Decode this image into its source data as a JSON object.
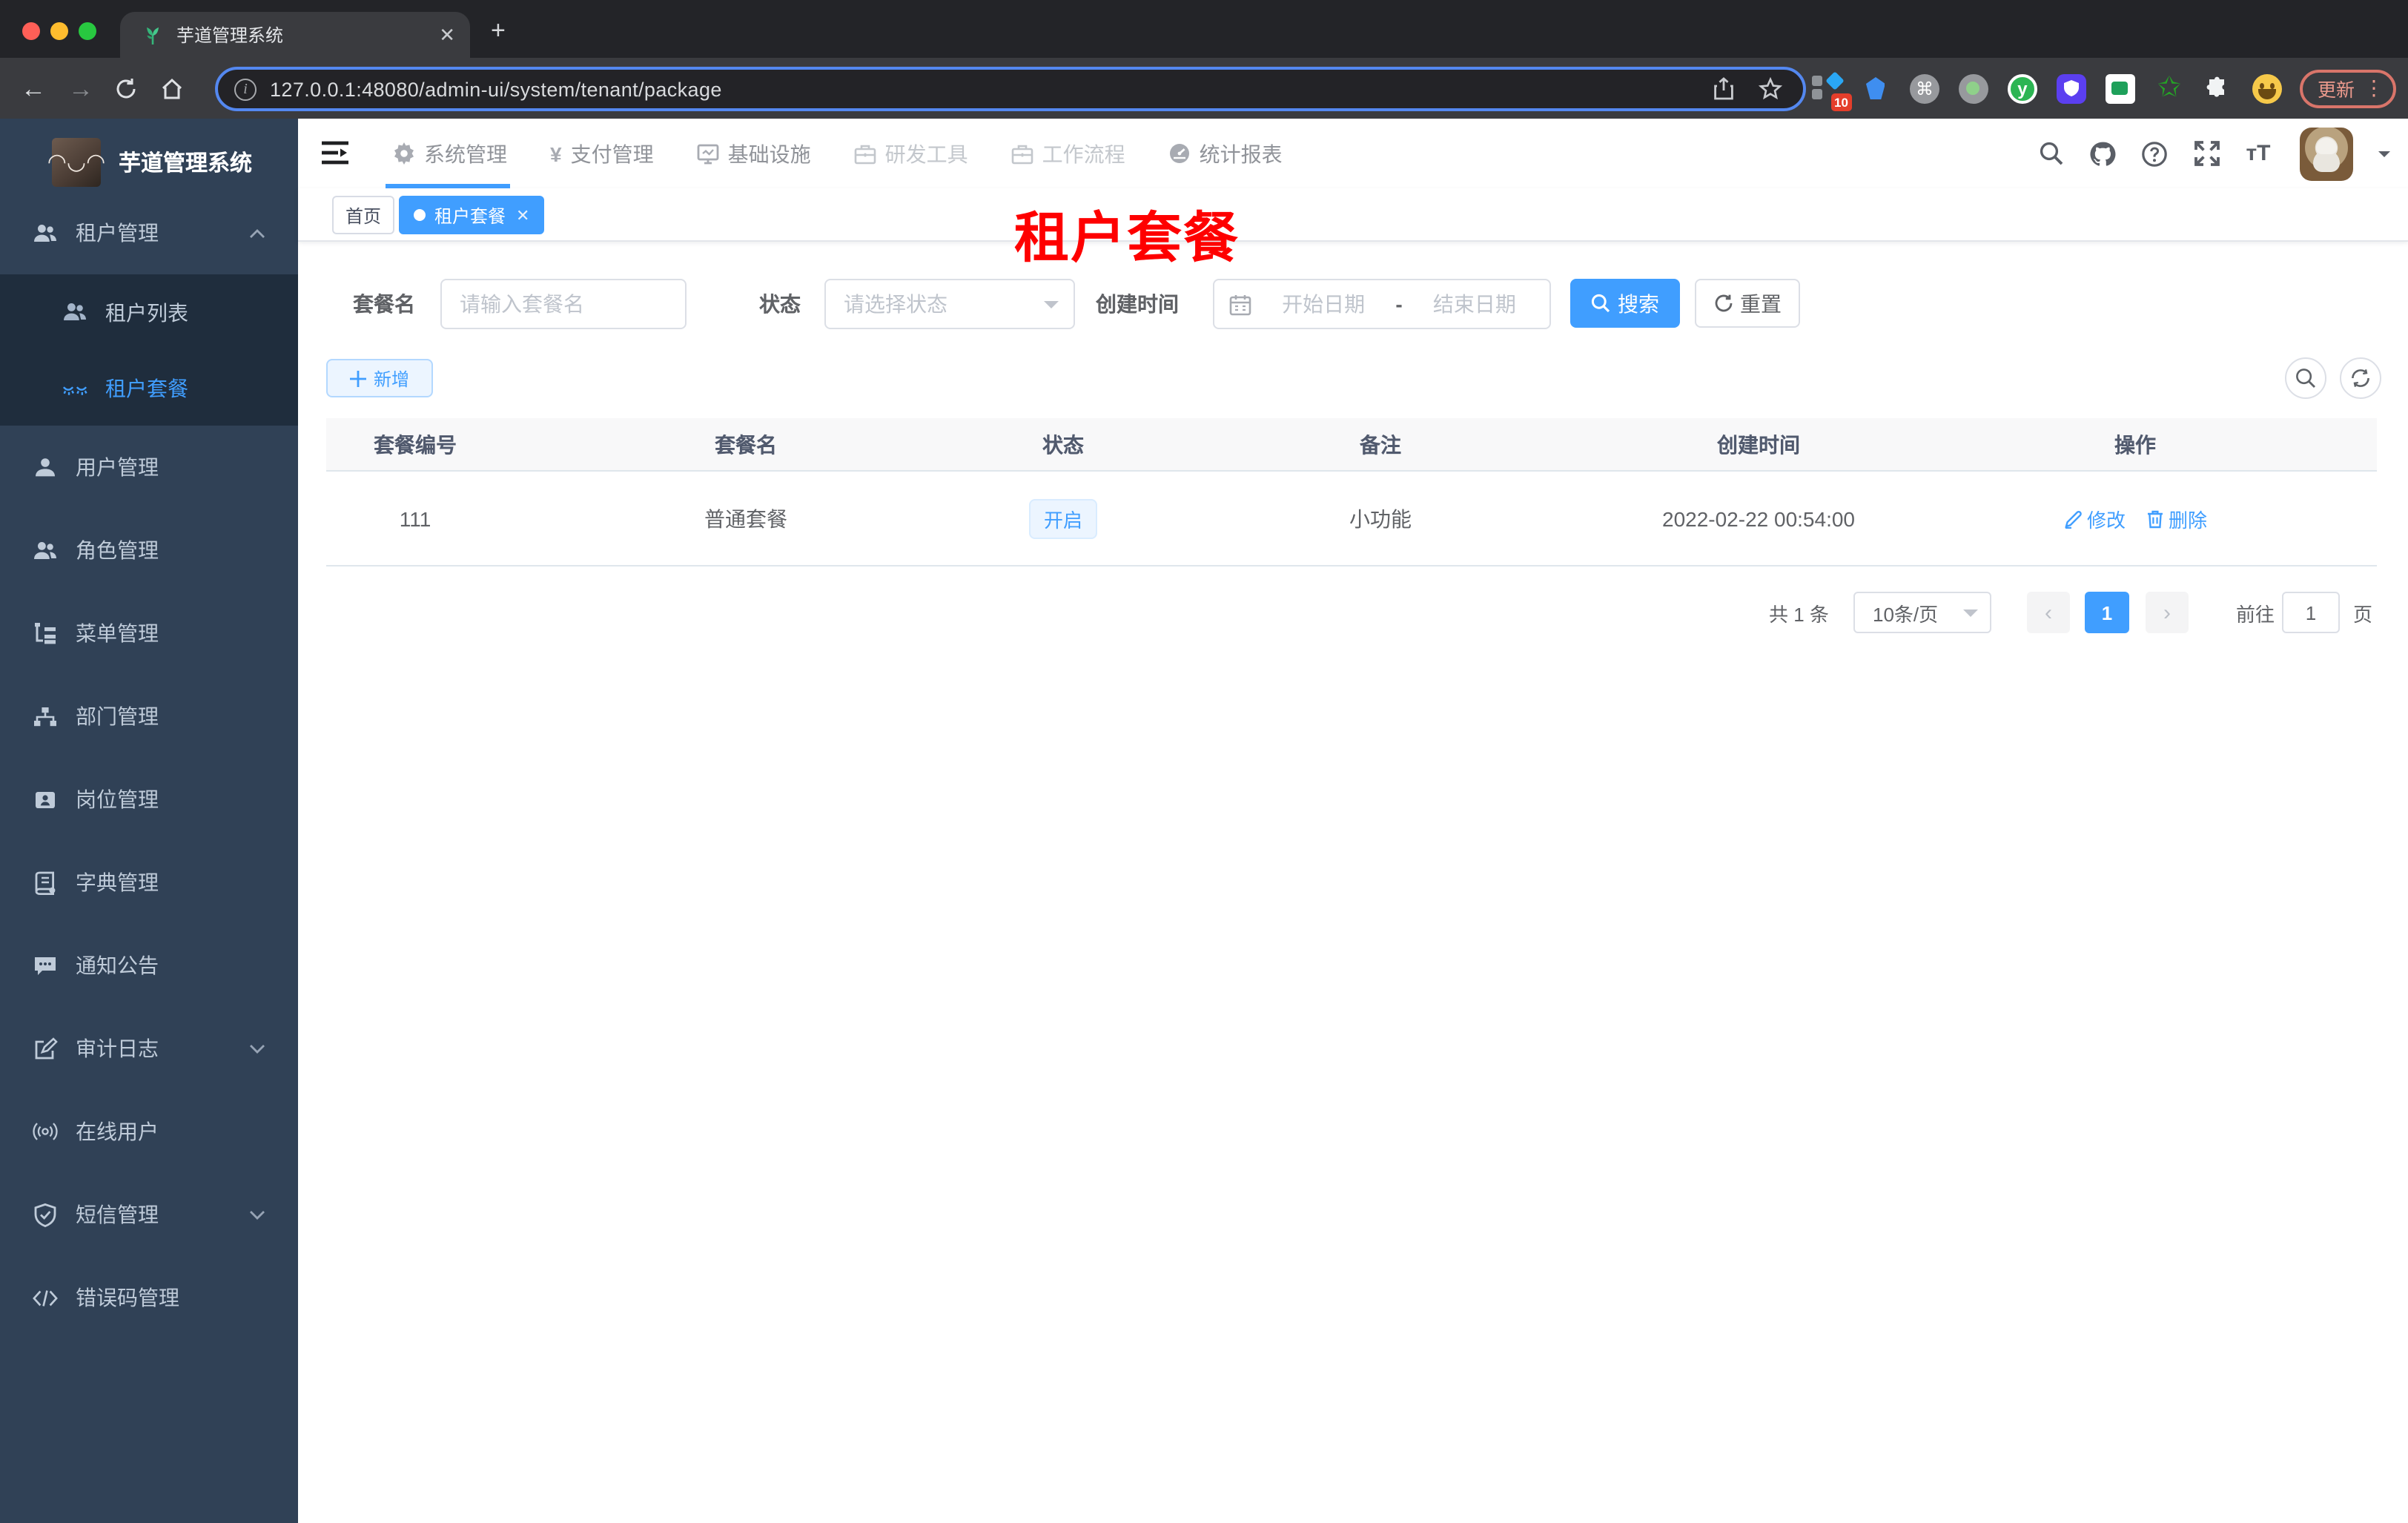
{
  "colors": {
    "accent": "#409eff",
    "sidebar_bg": "#304156",
    "submenu_bg": "#1f2d3d",
    "annotation_red": "#fe0000",
    "table_header_bg": "#f8f8f9",
    "tag_bg": "#ecf5ff",
    "tag_border": "#d9ecff"
  },
  "browser": {
    "tab_title": "芋道管理系统",
    "url": "127.0.0.1:48080/admin-ui/system/tenant/package",
    "extension_badge": "10",
    "update_label": "更新"
  },
  "sidebar": {
    "logo_title": "芋道管理系统",
    "items": [
      {
        "label": "租户管理"
      },
      {
        "label": "租户列表"
      },
      {
        "label": "租户套餐"
      },
      {
        "label": "用户管理"
      },
      {
        "label": "角色管理"
      },
      {
        "label": "菜单管理"
      },
      {
        "label": "部门管理"
      },
      {
        "label": "岗位管理"
      },
      {
        "label": "字典管理"
      },
      {
        "label": "通知公告"
      },
      {
        "label": "审计日志"
      },
      {
        "label": "在线用户"
      },
      {
        "label": "短信管理"
      },
      {
        "label": "错误码管理"
      }
    ]
  },
  "navbar": {
    "items": [
      {
        "label": "系统管理"
      },
      {
        "label": "支付管理"
      },
      {
        "label": "基础设施"
      },
      {
        "label": "研发工具"
      },
      {
        "label": "工作流程"
      },
      {
        "label": "统计报表"
      }
    ]
  },
  "tags": {
    "home": "首页",
    "active": "租户套餐"
  },
  "overlay_title": "租户套餐",
  "filters": {
    "name_label": "套餐名",
    "name_placeholder": "请输入套餐名",
    "status_label": "状态",
    "status_placeholder": "请选择状态",
    "date_label": "创建时间",
    "date_start_placeholder": "开始日期",
    "date_separator": "-",
    "date_end_placeholder": "结束日期",
    "search_label": "搜索",
    "reset_label": "重置"
  },
  "toolbar": {
    "add_label": "新增"
  },
  "table": {
    "headers": [
      "套餐编号",
      "套餐名",
      "状态",
      "备注",
      "创建时间",
      "操作"
    ],
    "rows": [
      {
        "id": "111",
        "name": "普通套餐",
        "status": "开启",
        "remark": "小功能",
        "created": "2022-02-22 00:54:00",
        "edit_label": "修改",
        "delete_label": "删除"
      }
    ]
  },
  "pagination": {
    "total": "共 1 条",
    "page_size": "10条/页",
    "current_page": "1",
    "goto_label": "前往",
    "goto_value": "1",
    "page_unit": "页"
  }
}
